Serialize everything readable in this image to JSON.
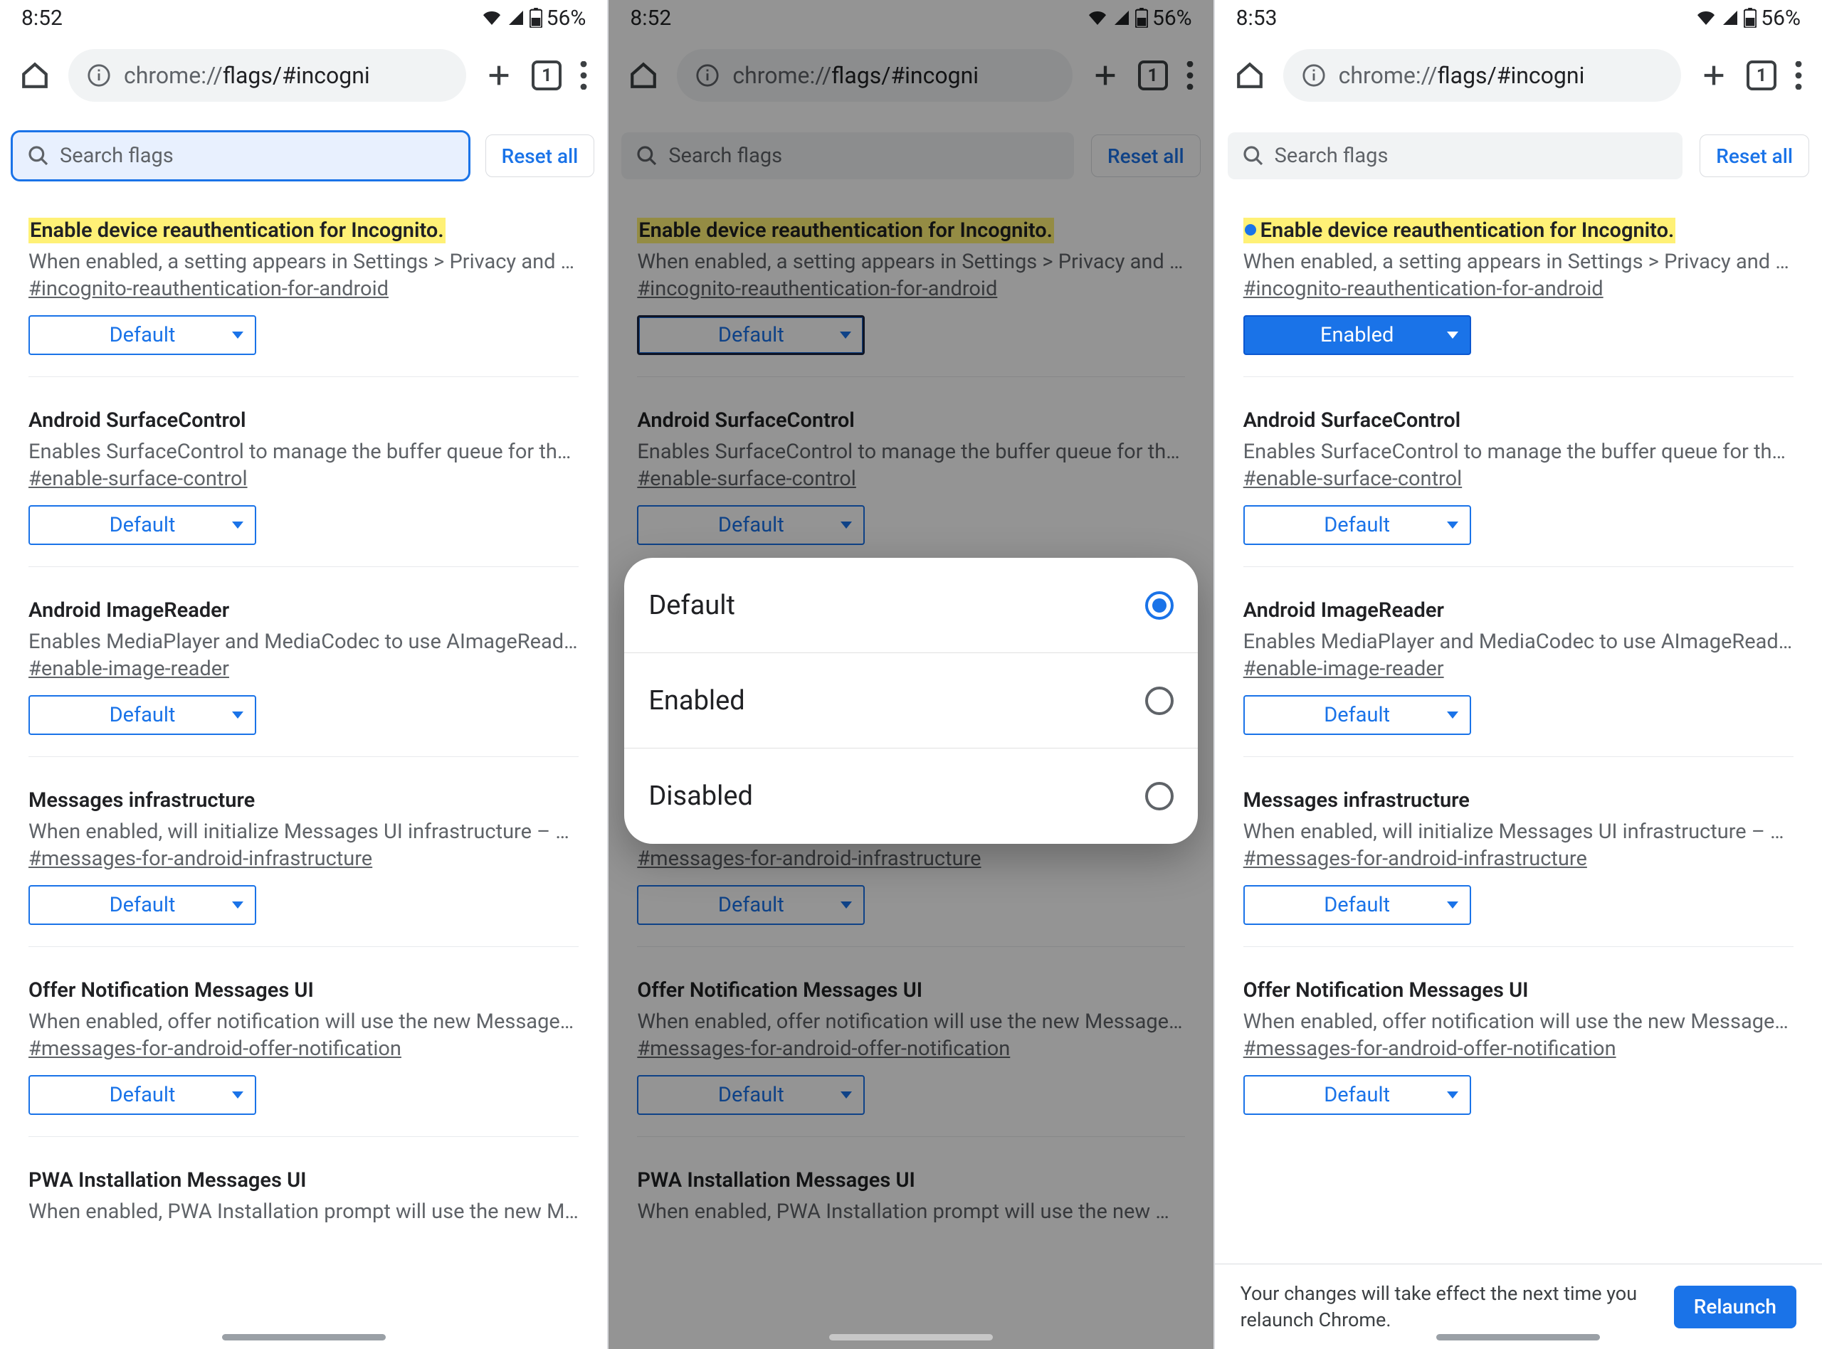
{
  "status": {
    "battery": "56%",
    "time_a": "8:52",
    "time_b": "8:52",
    "time_c": "8:53"
  },
  "browser": {
    "url_host": "chrome://",
    "url_path": "flags/#incogni",
    "tab_count": "1"
  },
  "toolbar": {
    "search_placeholder": "Search flags",
    "reset_label": "Reset all",
    "relaunch_label": "Relaunch"
  },
  "dialog": {
    "options": [
      "Default",
      "Enabled",
      "Disabled"
    ]
  },
  "relaunch_notice": "Your changes will take effect the next time you relaunch Chrome.",
  "flags": [
    {
      "title": "Enable device reauthentication for Incognito.",
      "desc": "When enabled, a setting appears in Settings > Privacy and Se…",
      "anchor": "#incognito-reauthentication-for-android",
      "value_default": "Default",
      "value_enabled": "Enabled",
      "highlight": true
    },
    {
      "title": "Android SurfaceControl",
      "desc": "Enables SurfaceControl to manage the buffer queue for the …",
      "anchor": "#enable-surface-control",
      "value": "Default"
    },
    {
      "title": "Android ImageReader",
      "desc": "Enables MediaPlayer and MediaCodec to use AImageReader…",
      "anchor": "#enable-image-reader",
      "value": "Default"
    },
    {
      "title": "Messages infrastructure",
      "desc": "When enabled, will initialize Messages UI infrastructure – An…",
      "anchor": "#messages-for-android-infrastructure",
      "value": "Default"
    },
    {
      "title": "Offer Notification Messages UI",
      "desc": "When enabled, offer notification will use the new Messages …",
      "anchor": "#messages-for-android-offer-notification",
      "value": "Default"
    },
    {
      "title": "PWA Installation Messages UI",
      "desc": "When enabled, PWA Installation prompt will use the new Mes…",
      "anchor": "",
      "value": "Default"
    }
  ]
}
